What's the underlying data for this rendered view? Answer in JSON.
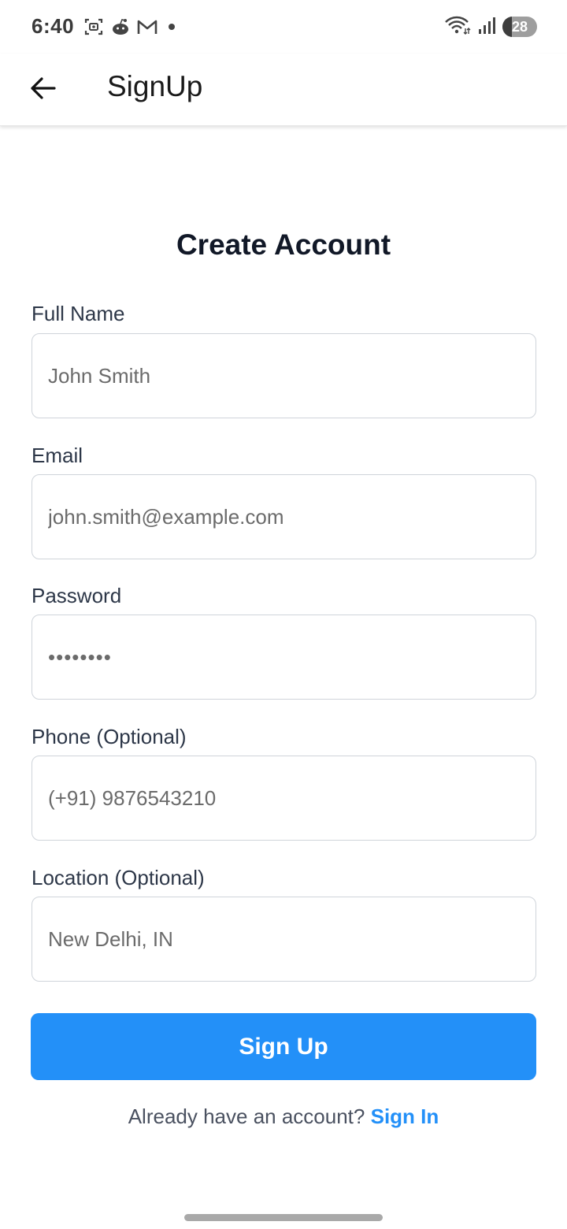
{
  "status_bar": {
    "time": "6:40",
    "left_icons": [
      "screenshot-icon",
      "reddit-icon",
      "gmail-icon",
      "notification-dot"
    ],
    "right_icons": [
      "wifi-icon",
      "signal-icon"
    ],
    "battery_level": "28",
    "battery_fraction": 0.28
  },
  "app_bar": {
    "back_icon": "arrow-left-icon",
    "title": "SignUp"
  },
  "form": {
    "title": "Create Account",
    "fields": {
      "full_name": {
        "label": "Full Name",
        "placeholder": "John Smith"
      },
      "email": {
        "label": "Email",
        "placeholder": "john.smith@example.com"
      },
      "password": {
        "label": "Password",
        "placeholder": "••••••••"
      },
      "phone": {
        "label": "Phone (Optional)",
        "placeholder": "(+91) 9876543210"
      },
      "location": {
        "label": "Location (Optional)",
        "placeholder": "New Delhi, IN"
      }
    },
    "submit_label": "Sign Up",
    "signin_prompt": "Already have an account?",
    "signin_link": "Sign In"
  },
  "colors": {
    "accent": "#2390f8",
    "title_text": "#111827",
    "input_border": "#cfd4da"
  }
}
